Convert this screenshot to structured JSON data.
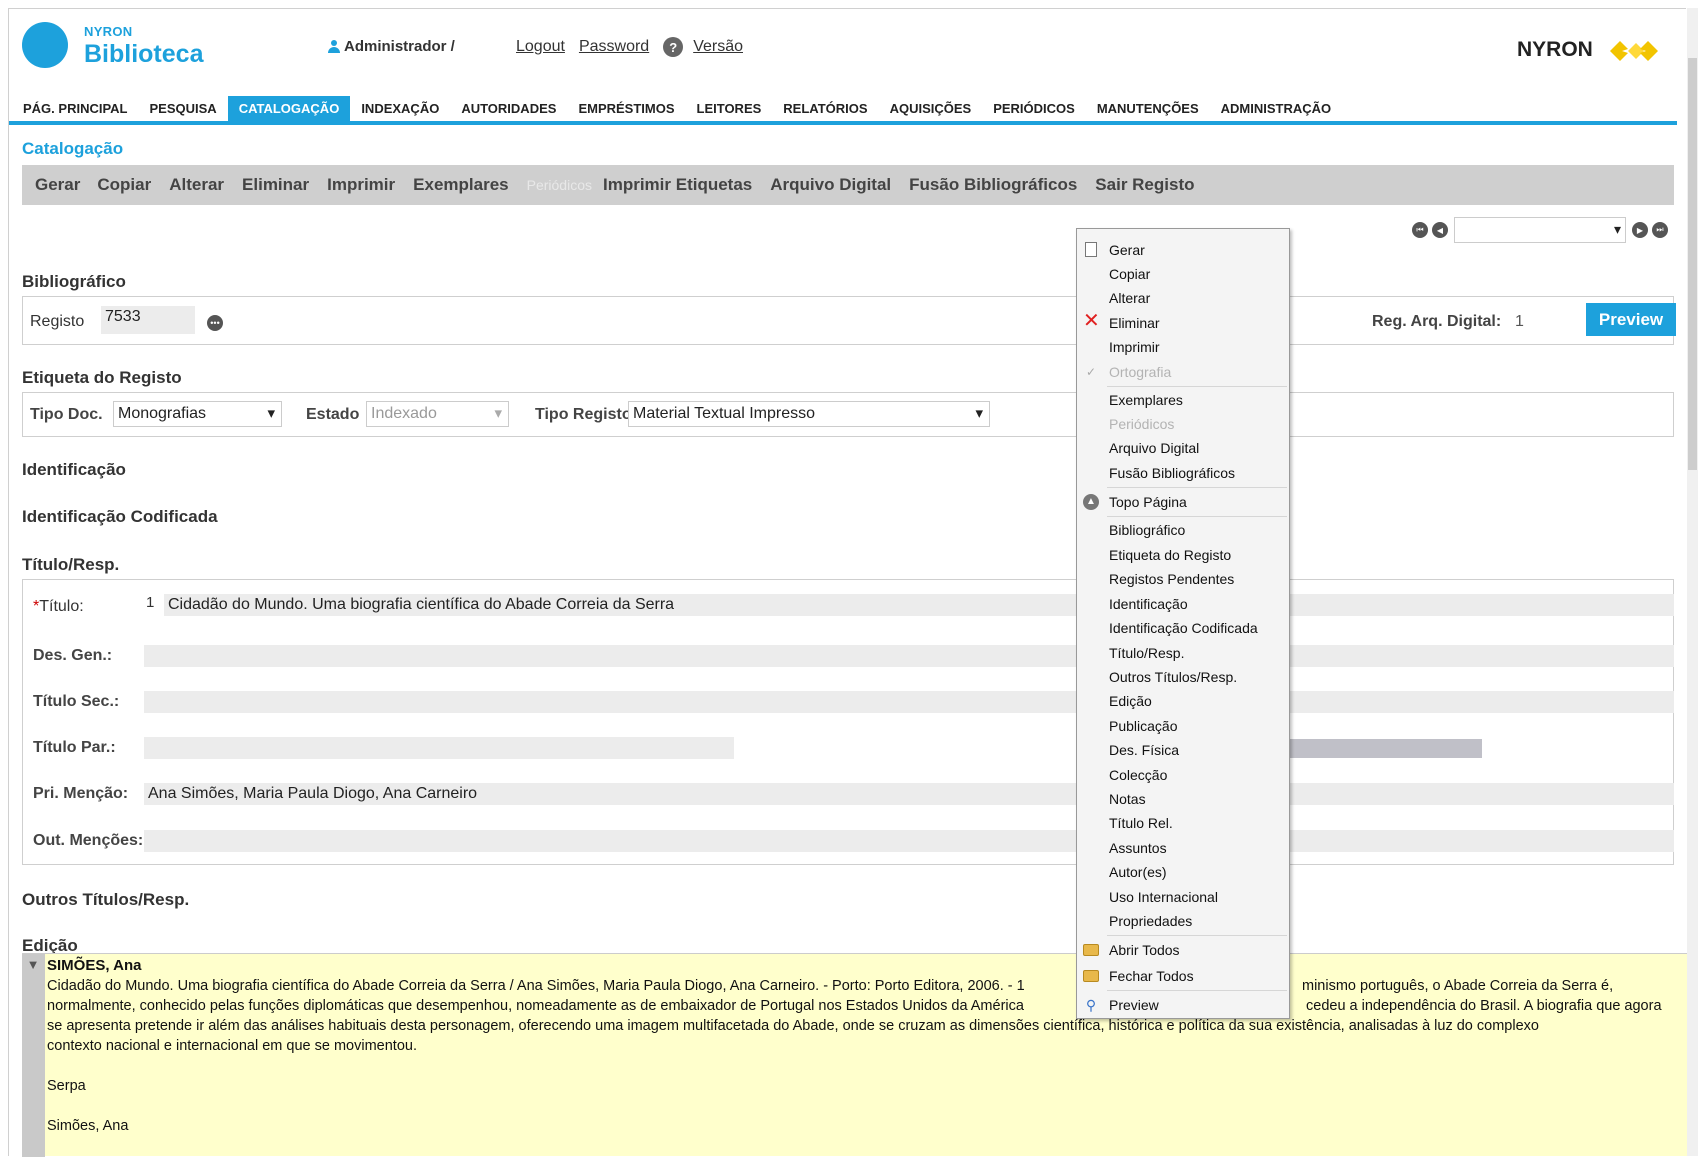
{
  "header": {
    "logo_small": "NYRON",
    "logo_big": "Biblioteca",
    "user": "Administrador /",
    "links": [
      "Logout",
      "Password",
      "Versão"
    ],
    "brand": "NYRON"
  },
  "nav": [
    "PÁG. PRINCIPAL",
    "PESQUISA",
    "CATALOGAÇÃO",
    "INDEXAÇÃO",
    "AUTORIDADES",
    "EMPRÉSTIMOS",
    "LEITORES",
    "RELATÓRIOS",
    "AQUISIÇÕES",
    "PERIÓDICOS",
    "MANUTENÇÕES",
    "ADMINISTRAÇÃO"
  ],
  "nav_active": "CATALOGAÇÃO",
  "section_title": "Catalogação",
  "toolbar": [
    "Gerar",
    "Copiar",
    "Alterar",
    "Eliminar",
    "Imprimir",
    "Exemplares",
    "Periódicos",
    "Imprimir Etiquetas",
    "Arquivo Digital",
    "Fusão Bibliográficos",
    "Sair Registo"
  ],
  "bibliografico": {
    "heading": "Bibliográfico",
    "registo_label": "Registo",
    "registo_value": "7533",
    "reg_arq_label": "Reg. Arq. Digital:",
    "reg_arq_value": "1",
    "preview": "Preview"
  },
  "etiqueta": {
    "heading": "Etiqueta do Registo",
    "tipo_doc_label": "Tipo Doc.",
    "tipo_doc_value": "Monografias",
    "estado_label": "Estado",
    "estado_value": "Indexado",
    "tipo_registo_label": "Tipo Registo",
    "tipo_registo_value": "Material Textual Impresso"
  },
  "sections": {
    "identificacao": "Identificação",
    "identificacao_codificada": "Identificação Codificada",
    "titulo_resp": "Título/Resp.",
    "outros_titulos": "Outros Títulos/Resp.",
    "edicao": "Edição"
  },
  "titulo_fields": {
    "titulo_label": "Título:",
    "titulo_num": "1",
    "titulo_value": "Cidadão do Mundo. Uma biografia científica do Abade Correia da Serra",
    "des_gen_label": "Des. Gen.:",
    "titulo_sec_label": "Título Sec.:",
    "titulo_par_label": "Título Par.:",
    "pri_mencao_label": "Pri. Menção:",
    "pri_mencao_value": "Ana Simões, Maria Paula Diogo, Ana Carneiro",
    "out_mencoes_label": "Out. Menções:"
  },
  "context_menu": [
    {
      "label": "Gerar",
      "icon": "new-document-icon"
    },
    {
      "label": "Copiar"
    },
    {
      "label": "Alterar"
    },
    {
      "label": "Eliminar",
      "icon": "delete-x-icon"
    },
    {
      "label": "Imprimir"
    },
    {
      "label": "Ortografia",
      "icon": "spellcheck-icon",
      "disabled": true
    },
    {
      "label": "Exemplares"
    },
    {
      "label": "Periódicos",
      "disabled": true
    },
    {
      "label": "Arquivo Digital"
    },
    {
      "label": "Fusão Bibliográficos"
    },
    {
      "label": "Topo Página",
      "icon": "top-page-icon"
    },
    {
      "label": "Bibliográfico"
    },
    {
      "label": "Etiqueta do Registo"
    },
    {
      "label": "Registos Pendentes"
    },
    {
      "label": "Identificação"
    },
    {
      "label": "Identificação Codificada"
    },
    {
      "label": "Título/Resp."
    },
    {
      "label": "Outros Títulos/Resp."
    },
    {
      "label": "Edição"
    },
    {
      "label": "Publicação"
    },
    {
      "label": "Des. Física"
    },
    {
      "label": "Colecção"
    },
    {
      "label": "Notas"
    },
    {
      "label": "Título Rel."
    },
    {
      "label": "Assuntos"
    },
    {
      "label": "Autor(es)"
    },
    {
      "label": "Uso Internacional"
    },
    {
      "label": "Propriedades"
    },
    {
      "label": "Abrir Todos",
      "icon": "folder-icon"
    },
    {
      "label": "Fechar Todos",
      "icon": "folder-icon"
    },
    {
      "label": "Preview",
      "icon": "magnifier-icon"
    }
  ],
  "preview_panel": {
    "author": "SIMÕES, Ana",
    "line1": "Cidadão do Mundo. Uma biografia científica do Abade Correia da Serra / Ana Simões, Maria Paula Diogo, Ana Carneiro. - Porto: Porto Editora, 2006. - 1",
    "line1_tail": "minismo português, o Abade Correia da Serra é,",
    "line2": "normalmente, conhecido pelas funções diplomáticas que desempenhou, nomeadamente as de embaixador de Portugal nos Estados Unidos da América",
    "line2_tail": "cedeu a independência do Brasil. A biografia que agora",
    "line3": "se apresenta pretende ir além das análises habituais desta personagem, oferecendo uma imagem multifacetada do Abade, onde se cruzam as dimensões científica, histórica e política da sua existência, analisadas à luz do complexo",
    "line4": "contexto nacional e internacional em que se movimentou.",
    "subject": "Serpa",
    "author2": "Simões, Ana"
  }
}
